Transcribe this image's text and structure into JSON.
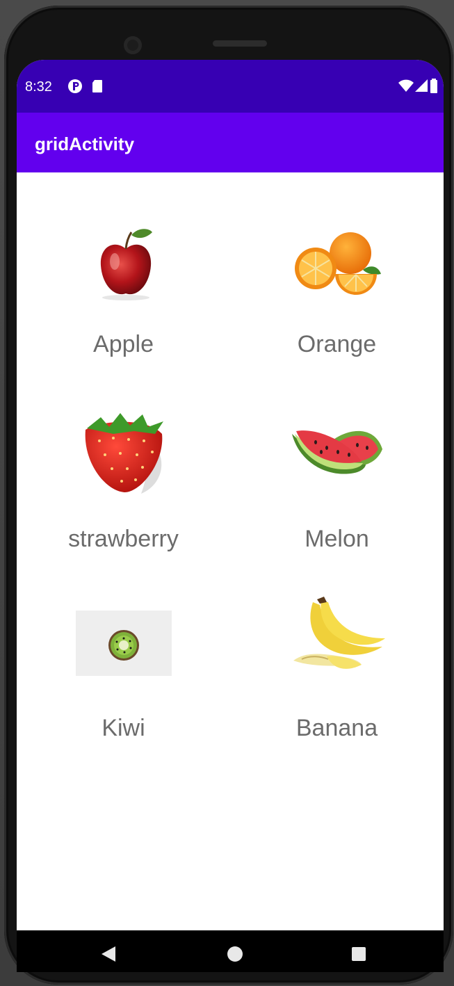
{
  "status_bar": {
    "time": "8:32"
  },
  "app_bar": {
    "title": "gridActivity"
  },
  "grid": {
    "items": [
      {
        "label": "Apple",
        "icon": "apple-image"
      },
      {
        "label": "Orange",
        "icon": "orange-image"
      },
      {
        "label": "strawberry",
        "icon": "strawberry-image"
      },
      {
        "label": "Melon",
        "icon": "watermelon-image"
      },
      {
        "label": "Kiwi",
        "icon": "kiwi-image"
      },
      {
        "label": "Banana",
        "icon": "banana-image"
      }
    ]
  },
  "colors": {
    "status_bar": "#3700b3",
    "app_bar": "#6200ee",
    "label_text": "#6b6b6b",
    "nav_bar": "#000000"
  },
  "nav_bar": {
    "icons": [
      "back-icon",
      "home-icon",
      "recents-icon"
    ]
  }
}
